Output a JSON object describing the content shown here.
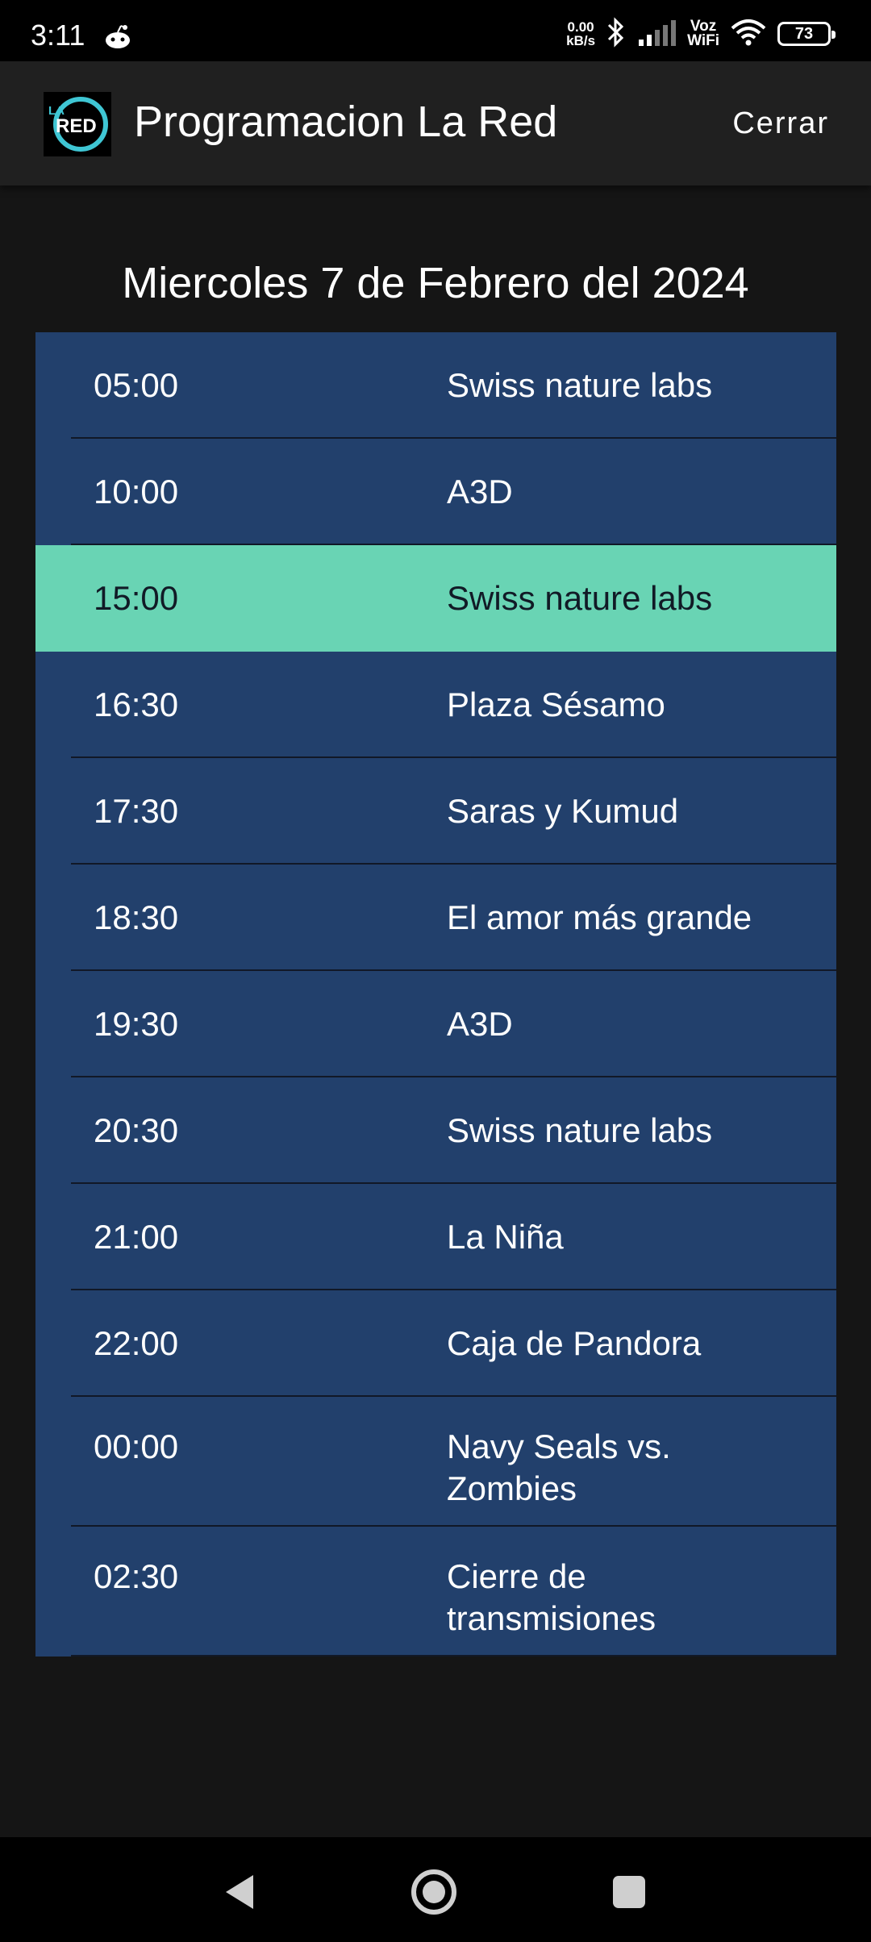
{
  "status_bar": {
    "time": "3:11",
    "net_speed_value": "0.00",
    "net_speed_unit": "kB/s",
    "voz_line1": "Voz",
    "voz_line2": "WiFi",
    "battery": "73",
    "icons": [
      "reddit-icon",
      "bluetooth-icon",
      "signal-icon",
      "wifi-icon",
      "battery-icon"
    ]
  },
  "app_bar": {
    "logo_icon": "la-red-logo",
    "title": "Programacion La Red",
    "close_label": "Cerrar"
  },
  "date_heading": "Miercoles 7 de Febrero del 2024",
  "schedule": [
    {
      "time": "05:00",
      "program": "Swiss nature labs",
      "active": false
    },
    {
      "time": "10:00",
      "program": "A3D",
      "active": false
    },
    {
      "time": "15:00",
      "program": "Swiss nature labs",
      "active": true
    },
    {
      "time": "16:30",
      "program": "Plaza Sésamo",
      "active": false
    },
    {
      "time": "17:30",
      "program": "Saras y Kumud",
      "active": false
    },
    {
      "time": "18:30",
      "program": "El amor más grande",
      "active": false
    },
    {
      "time": "19:30",
      "program": "A3D",
      "active": false
    },
    {
      "time": "20:30",
      "program": "Swiss nature labs",
      "active": false
    },
    {
      "time": "21:00",
      "program": "La Niña",
      "active": false
    },
    {
      "time": "22:00",
      "program": "Caja de Pandora",
      "active": false
    },
    {
      "time": "00:00",
      "program": "Navy Seals vs. Zombies",
      "active": false
    },
    {
      "time": "02:30",
      "program": "Cierre de transmisiones",
      "active": false
    }
  ],
  "colors": {
    "background": "#151515",
    "app_bar": "#202020",
    "row_background": "#22406c",
    "active_row": "#69d4b4",
    "logo_ring": "#3fc6d4"
  },
  "nav_bar": {
    "icons": [
      "back-icon",
      "home-icon",
      "recents-icon"
    ]
  }
}
